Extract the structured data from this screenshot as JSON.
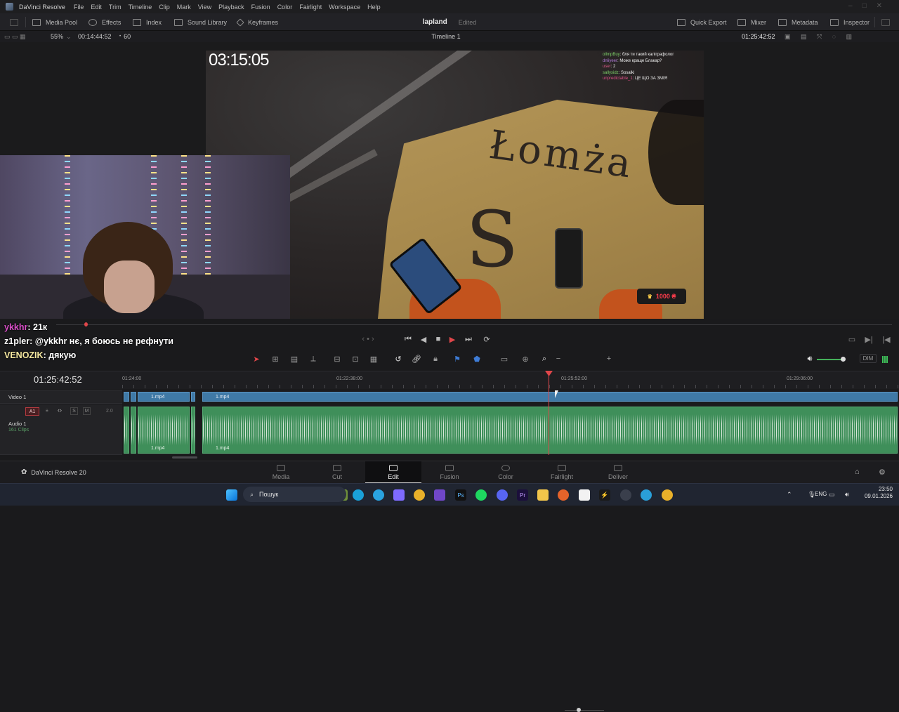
{
  "menubar": {
    "app_name": "DaVinci Resolve",
    "items": [
      "File",
      "Edit",
      "Trim",
      "Timeline",
      "Clip",
      "Mark",
      "View",
      "Playback",
      "Fusion",
      "Color",
      "Fairlight",
      "Workspace",
      "Help"
    ]
  },
  "toolbar": {
    "media_pool": "Media Pool",
    "effects": "Effects",
    "index": "Index",
    "sound_library": "Sound Library",
    "keyframes": "Keyframes",
    "project_name": "lapland",
    "project_status": "Edited",
    "quick_export": "Quick Export",
    "mixer": "Mixer",
    "metadata": "Metadata",
    "inspector": "Inspector"
  },
  "viewer": {
    "zoom": "55%",
    "source_timecode": "00:14:44:52",
    "frame_rate": "60",
    "timeline_name": "Timeline 1",
    "record_timecode": "01:25:42:52",
    "overlay_timer": "03:15:05",
    "donation_amount": "1000 ₴",
    "cardboard_text": "Łomża",
    "stream_chat": [
      {
        "user": "ollmpBuy",
        "text": "бля ти такий каліграфолог"
      },
      {
        "user": "dnliyeer",
        "text": "Може краще Блакар?"
      },
      {
        "user": "user",
        "text": "2"
      },
      {
        "user": "sallyxidz",
        "text": "Sosalki"
      },
      {
        "user": "unpredictable_1",
        "text": "ЦЕ ЩО ЗА ЗМІЯ"
      }
    ]
  },
  "chat_left": [
    {
      "user": "ykkhr",
      "text": ": 21к",
      "user_color": "#d94ec8"
    },
    {
      "user": "z1pler",
      "text": ": @ykkhr нє, я боюсь не рефнути",
      "user_color": "#ffffff"
    },
    {
      "user": "VENOZIK",
      "text": ": дякую",
      "user_color": "#f6e8a0"
    }
  ],
  "transport": {
    "buttons": [
      "skip-start",
      "prev-frame",
      "stop",
      "play",
      "skip-end",
      "loop"
    ],
    "dim_label": "DIM"
  },
  "timeline": {
    "timecode": "01:25:42:52",
    "ruler_labels": [
      "01:24:00",
      "01:22:38:00",
      "01:25:52:00",
      "01:29:06:00"
    ],
    "video_track_name": "Video 1",
    "audio_track_id": "A1",
    "audio_track_name": "Audio 1",
    "audio_track_clips": "161 Clips",
    "audio_level": "2.0",
    "clip_name": "1.mp4"
  },
  "pages": [
    {
      "label": "Media",
      "active": false
    },
    {
      "label": "Cut",
      "active": false
    },
    {
      "label": "Edit",
      "active": true
    },
    {
      "label": "Fusion",
      "active": false
    },
    {
      "label": "Color",
      "active": false
    },
    {
      "label": "Fairlight",
      "active": false
    },
    {
      "label": "Deliver",
      "active": false
    }
  ],
  "brand": "DaVinci Resolve 20",
  "taskbar": {
    "search_placeholder": "Пошук",
    "language": "ENG",
    "time": "23:50",
    "date": "09.01.2026"
  },
  "colors": {
    "video_clip": "#3f79a6",
    "audio_clip": "#3f8f5a",
    "playhead": "#e0464a",
    "accent_play": "#e0464a"
  }
}
